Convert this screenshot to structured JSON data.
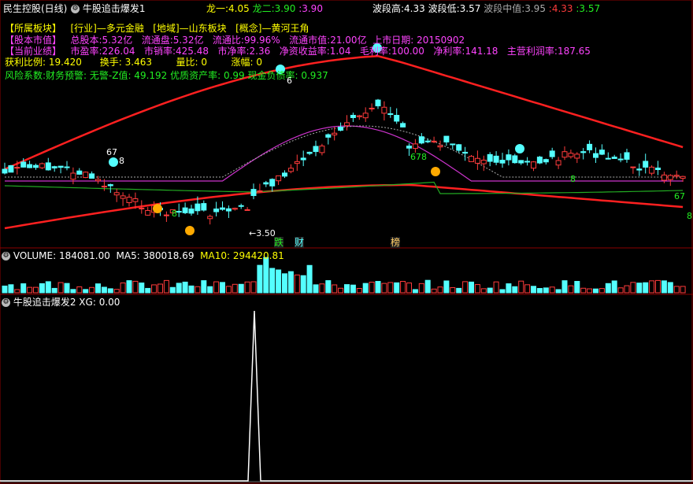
{
  "header": {
    "stock_name": "民生控股(日线)",
    "indicator": "牛股追击爆发1",
    "long1_label": "龙一:",
    "long1_value": "4.05",
    "long2_label": "龙二:",
    "long2_value": "3.90",
    "colon3": ":",
    "colon3_value": "3.90",
    "bo_high_label": "波段高:",
    "bo_high_value": "4.33",
    "bo_low_label": "波段低:",
    "bo_low_value": "3.57",
    "bo_mid_label": "波段中值:",
    "bo_mid_value": "3.95",
    "extra1": ":",
    "extra1_value": "4.33",
    "extra2": ":",
    "extra2_value": "3.57"
  },
  "info": {
    "row1": [
      "【所属板块】",
      "[行业]—多元金融",
      "[地域]—山东板块",
      "[概念]—黄河王角"
    ],
    "row2": [
      "【股本市值】",
      "总股本:5.32亿",
      "流通盘:5.32亿",
      "流通比:99.96%",
      "流通市值:21.00亿",
      "上市日期: 20150902"
    ],
    "row3": [
      "【当前业绩】",
      "市盈率:226.04",
      "市销率:425.48",
      "市净率:2.36",
      "净资收益率:1.04",
      "毛利率:100.00",
      "净利率:141.18",
      "主营利润率:187.65"
    ],
    "row4": [
      "获利比例:",
      "19.420",
      "换手:",
      "3.463",
      "量比:",
      "0",
      "涨幅:",
      "0"
    ],
    "row5": "风险系数:财务预警: 无警-Z值: 49.192 优质资产率: 0.99 现金负债率: 0.937"
  },
  "chart_markers": {
    "low_price": "3.50",
    "badge_die": "跌",
    "badge_cai": "财",
    "badge_bang": "榜",
    "label_67": "67",
    "label_8a": "8",
    "label_6": "6",
    "label_8b": "8",
    "label_678": "678",
    "label_8c": "8",
    "label_67b": "67",
    "label_8d": "8"
  },
  "volume_panel": {
    "label": "VOLUME:",
    "value": "184081.00",
    "ma5_label": "MA5:",
    "ma5_value": "380018.69",
    "ma10_label": "MA10:",
    "ma10_value": "294420.81"
  },
  "xg_panel": {
    "title": "牛股追击爆发2",
    "xg_label": "XG:",
    "xg_value": "0.00"
  },
  "colors": {
    "bg": "#000000",
    "up": "#ff3b3b",
    "down": "#54ffff",
    "ma_red": "#ff2020",
    "ma_green": "#22aa22",
    "ma_magenta": "#cc33cc",
    "yellow": "#ffff00",
    "magenta_text": "#ff44ff",
    "green_text": "#22ee22"
  }
}
